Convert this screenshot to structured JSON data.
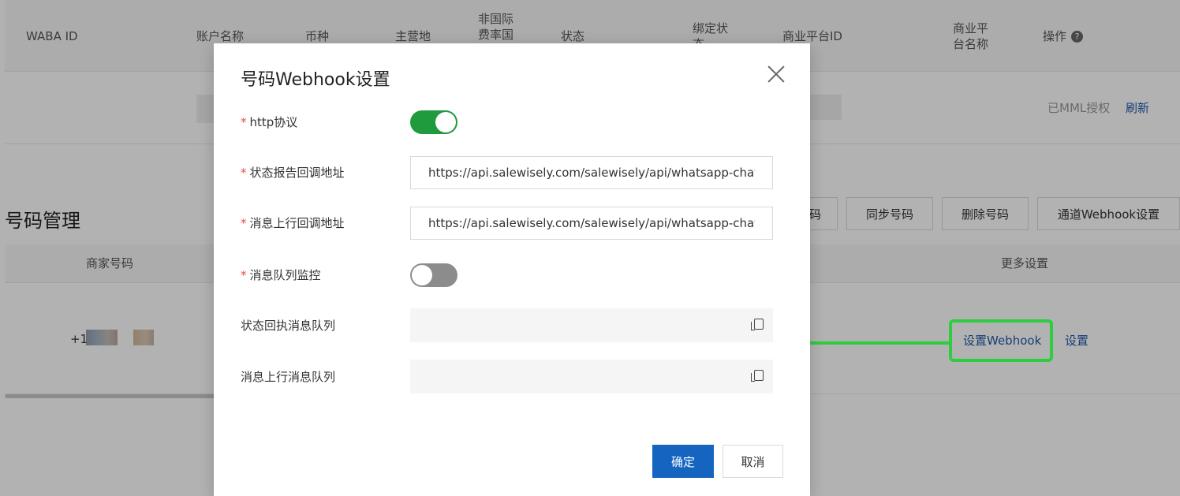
{
  "table": {
    "headers": {
      "waba_id": "WABA ID",
      "account_name": "账户名称",
      "currency": "币种",
      "region": "主营地",
      "non_intl_rate_1": "非国际",
      "non_intl_rate_2": "费率国",
      "status": "状态",
      "bind_status_1": "绑定状",
      "bind_status_2": "态",
      "biz_platform_id": "商业平台ID",
      "biz_platform_name_1": "商业平",
      "biz_platform_name_2": "台名称",
      "operation": "操作"
    },
    "mml_status": "已MML授权",
    "refresh": "刷新"
  },
  "numbers": {
    "title": "号码管理",
    "buttons": {
      "partial": "码",
      "sync": "同步号码",
      "delete": "删除号码",
      "channel_webhook": "通道Webhook设置"
    },
    "headers": {
      "merchant_number": "商家号码",
      "more_settings": "更多设置"
    },
    "row": {
      "phone_prefix": "+1",
      "set_webhook": "设置Webhook",
      "settings": "设置"
    }
  },
  "modal": {
    "title": "号码Webhook设置",
    "fields": {
      "http": {
        "label": "http协议",
        "required": "*",
        "enabled": true
      },
      "status_callback": {
        "label": "状态报告回调地址",
        "required": "*",
        "value": "https://api.salewisely.com/salewisely/api/whatsapp-chatapi/callback"
      },
      "msg_callback": {
        "label": "消息上行回调地址",
        "required": "*",
        "value": "https://api.salewisely.com/salewisely/api/whatsapp-chatapi/message"
      },
      "queue_monitor": {
        "label": "消息队列监控",
        "required": "*",
        "enabled": false
      },
      "status_queue": {
        "label": "状态回执消息队列"
      },
      "msg_queue": {
        "label": "消息上行消息队列"
      }
    },
    "ok": "确定",
    "cancel": "取消"
  },
  "colors": {
    "primary": "#1565c0",
    "toggle_on": "#1f9a3c",
    "annotation": "#2ecc40",
    "link": "#1f5aa8"
  }
}
